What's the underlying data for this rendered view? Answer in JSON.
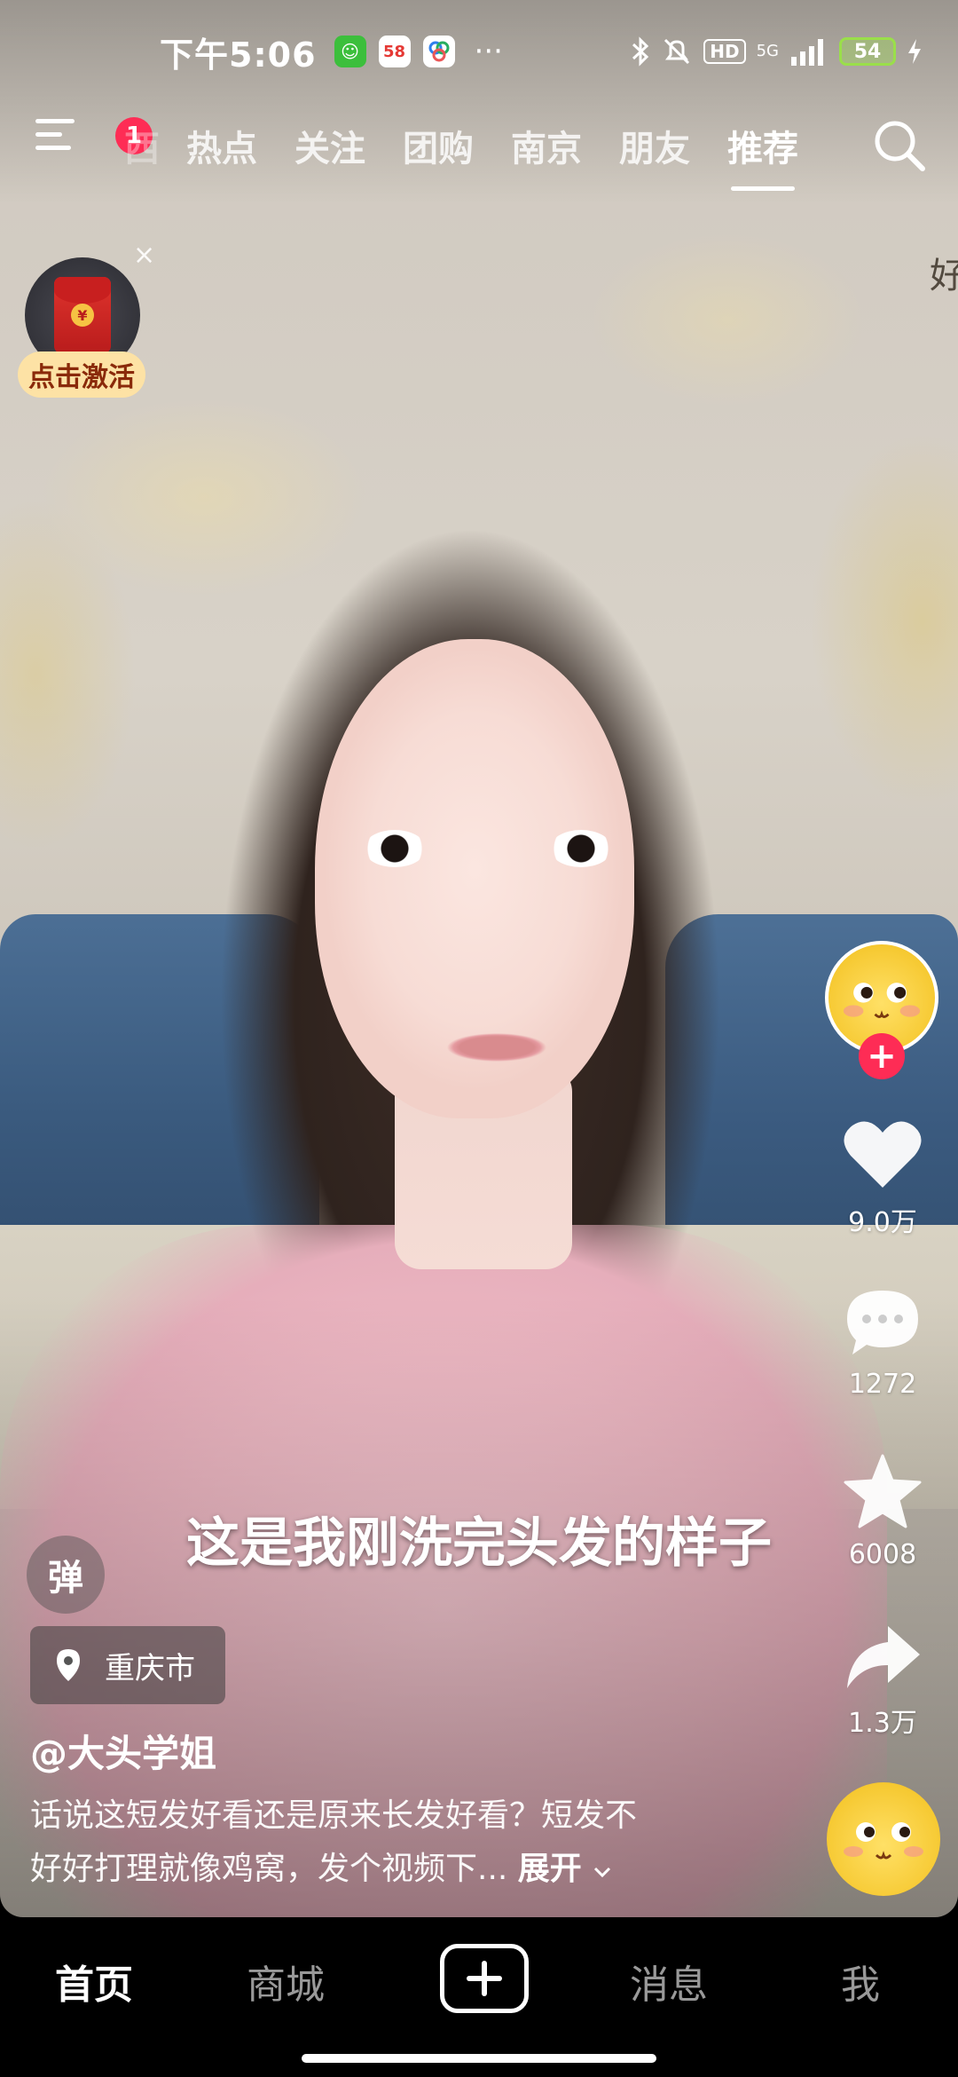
{
  "status_bar": {
    "time": "下午5:06",
    "app_badge_58": "58",
    "more": "···",
    "hd": "HD",
    "network": "5G",
    "battery": "54"
  },
  "top_nav": {
    "notification_count": "1",
    "tabs": [
      {
        "label": "西",
        "state": "faded"
      },
      {
        "label": "热点",
        "state": "normal"
      },
      {
        "label": "关注",
        "state": "normal"
      },
      {
        "label": "团购",
        "state": "normal"
      },
      {
        "label": "南京",
        "state": "normal"
      },
      {
        "label": "朋友",
        "state": "normal"
      },
      {
        "label": "推荐",
        "state": "active"
      }
    ]
  },
  "red_packet": {
    "label": "点击激活",
    "coin": "¥",
    "close": "×"
  },
  "edge_text": "好",
  "actions": {
    "likes": "9.0万",
    "comments": "1272",
    "favorites": "6008",
    "shares": "1.3万"
  },
  "overlay_caption": "这是我刚洗完头发的样子",
  "danmu_label": "弹",
  "location": "重庆市",
  "author": "@大头学姐",
  "description": {
    "line1": "话说这短发好看还是原来长发好看？短发不",
    "line2": "好好打理就像鸡窝，发个视频下...",
    "expand": "展开"
  },
  "bottom_nav": {
    "home": "首页",
    "mall": "商城",
    "messages": "消息",
    "me": "我"
  },
  "colors": {
    "accent_red": "#fe2c55",
    "battery_green": "#9adf4a",
    "packet_label_bg": "#fde2a5"
  }
}
